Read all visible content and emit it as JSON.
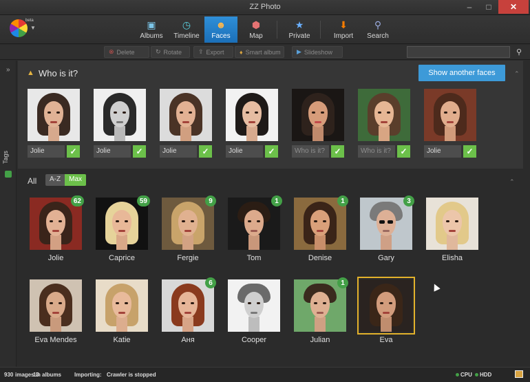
{
  "window": {
    "title": "ZZ Photo",
    "logo_badge": "beta"
  },
  "nav": [
    {
      "label": "Albums",
      "icon": "albums-icon"
    },
    {
      "label": "Timeline",
      "icon": "timeline-icon"
    },
    {
      "label": "Faces",
      "icon": "faces-icon",
      "active": true
    },
    {
      "label": "Map",
      "icon": "map-icon"
    },
    {
      "label": "Private",
      "icon": "private-icon"
    },
    {
      "label": "Import",
      "icon": "import-icon"
    },
    {
      "label": "Search",
      "icon": "search-icon"
    }
  ],
  "actions": [
    "Delete",
    "Rotate",
    "Export",
    "Smart album",
    "Slideshow"
  ],
  "sidebar": {
    "label": "Tags"
  },
  "who": {
    "heading": "Who is it?",
    "show_button": "Show another faces",
    "cards": [
      {
        "name": "Jolie",
        "placeholder": ""
      },
      {
        "name": "Jolie",
        "placeholder": ""
      },
      {
        "name": "Jolie",
        "placeholder": ""
      },
      {
        "name": "Jolie",
        "placeholder": ""
      },
      {
        "name": "",
        "placeholder": "Who is it?"
      },
      {
        "name": "",
        "placeholder": "Who is it?"
      },
      {
        "name": "Jolie",
        "placeholder": ""
      }
    ]
  },
  "faces": {
    "all_label": "All",
    "sort_az": "A-Z",
    "sort_max": "Max",
    "people": [
      {
        "name": "Jolie",
        "count": "62"
      },
      {
        "name": "Caprice",
        "count": "59"
      },
      {
        "name": "Fergie",
        "count": "9"
      },
      {
        "name": "Tom",
        "count": "1"
      },
      {
        "name": "Denise",
        "count": "1"
      },
      {
        "name": "Gary",
        "count": "3"
      },
      {
        "name": "Elisha",
        "count": ""
      },
      {
        "name": "Eva Mendes",
        "count": ""
      },
      {
        "name": "Katie",
        "count": ""
      },
      {
        "name": "Аня",
        "count": "6"
      },
      {
        "name": "Cooper",
        "count": ""
      },
      {
        "name": "Julian",
        "count": "1"
      },
      {
        "name": "Eva",
        "count": ""
      }
    ]
  },
  "status": {
    "images": "930",
    "images_text": "images in",
    "albums": "13",
    "albums_text": "albums",
    "importing_label": "Importing:",
    "importing_value": "Crawler is stopped",
    "cpu": "CPU",
    "hdd": "HDD"
  },
  "colors": {
    "accent": "#3d9ad8",
    "ok": "#6cc04a",
    "badge": "#43a047",
    "selected": "#e3b22b"
  }
}
